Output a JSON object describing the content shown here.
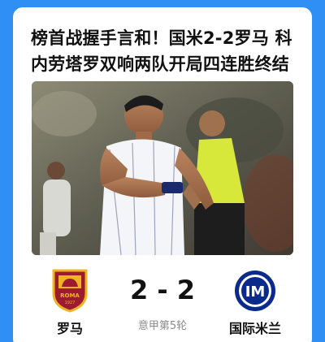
{
  "article": {
    "headline": "榜首战握手言和！国米2-2罗马 科内劳塔罗双响两队开局四连胜终结"
  },
  "match": {
    "home_team": "罗马",
    "away_team": "国际米兰",
    "score": "2 - 2",
    "round": "意甲第5轮"
  },
  "badges": {
    "home_badge_text": "ROMA",
    "home_badge_year": "1927",
    "away_badge_text": "IM"
  },
  "colors": {
    "background": "#2f8ff4",
    "card": "#ffffff",
    "roma_red": "#9c1b2f",
    "roma_gold": "#f0b323",
    "inter_blue": "#0a2a8c",
    "referee_yellow": "#d8e83a"
  }
}
